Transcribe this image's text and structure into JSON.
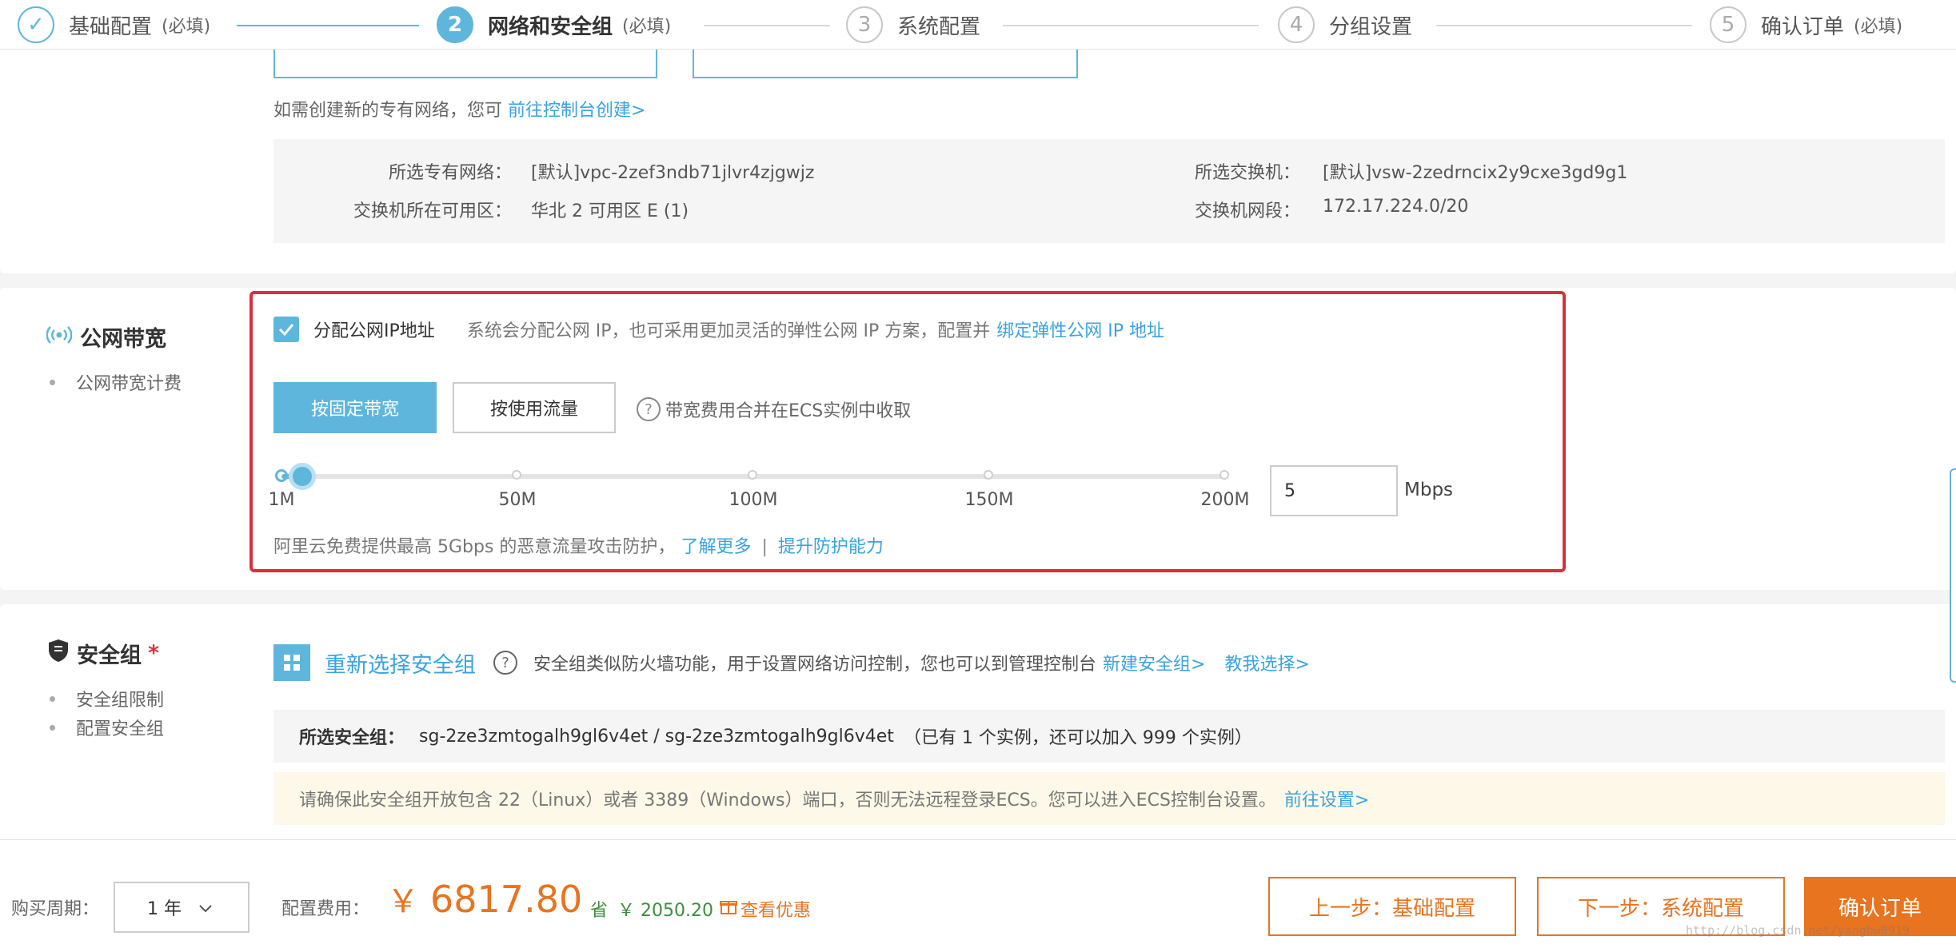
{
  "steps": [
    {
      "num": "✓",
      "label": "基础配置",
      "req": "(必填)"
    },
    {
      "num": "2",
      "label": "网络和安全组",
      "req": "(必填)"
    },
    {
      "num": "3",
      "label": "系统配置",
      "req": ""
    },
    {
      "num": "4",
      "label": "分组设置",
      "req": ""
    },
    {
      "num": "5",
      "label": "确认订单",
      "req": "(必填)"
    }
  ],
  "vpc": {
    "hint": "如需创建新的专有网络，您可",
    "hint_link": "前往控制台创建>",
    "vpc_label": "所选专有网络：",
    "vpc_value": "[默认]vpc-2zef3ndb71jlvr4zjgwjz",
    "zone_label": "交换机所在可用区：",
    "zone_value": "华北 2 可用区 E (1)",
    "switch_label": "所选交换机：",
    "switch_value": "[默认]vsw-2zedrncix2y9cxe3gd9g1",
    "cidr_label": "交换机网段：",
    "cidr_value": "172.17.224.0/20"
  },
  "bandwidth": {
    "title": "公网带宽",
    "bullet": "公网带宽计费",
    "assign_ip_checked": true,
    "assign_ip_label": "分配公网IP地址",
    "assign_desc": "系统会分配公网 IP，也可采用更加灵活的弹性公网 IP 方案，配置并",
    "assign_link": "绑定弹性公网 IP 地址",
    "fixed_btn": "按固定带宽",
    "traffic_btn": "按使用流量",
    "fee_note": "带宽费用合并在ECS实例中收取",
    "ticks": [
      "1M",
      "50M",
      "100M",
      "150M",
      "200M"
    ],
    "slider_min": 1,
    "slider_max": 200,
    "slider_value": 5,
    "input_value": "5",
    "unit": "Mbps",
    "ddos_text": "阿里云免费提供最高 5Gbps 的恶意流量攻击防护，",
    "learn_more": "了解更多",
    "separator": "|",
    "upgrade": "提升防护能力",
    "accent": "#5fb6dd",
    "highlight": "#d7303d"
  },
  "security": {
    "title": "安全组",
    "required_mark": "*",
    "bullets": [
      "安全组限制",
      "配置安全组"
    ],
    "reselect": "重新选择安全组",
    "desc": "安全组类似防火墙功能，用于设置网络访问控制，您也可以到管理控制台",
    "new_link": "新建安全组>",
    "teach_link": "教我选择>",
    "selected_label": "所选安全组：",
    "selected_value": "sg-2ze3zmtogalh9gl6v4et  / sg-2ze3zmtogalh9gl6v4et",
    "selected_note": "（已有 1 个实例，还可以加入 999 个实例）",
    "warning": "请确保此安全组开放包含 22（Linux）或者 3389（Windows）端口，否则无法远程登录ECS。您可以进入ECS控制台设置。",
    "warning_link": "前往设置>"
  },
  "footer": {
    "period_label": "购买周期：",
    "period_value": "1 年",
    "fee_label": "配置费用：",
    "currency": "￥",
    "price": "6817.80",
    "save_label": "省",
    "save_amount": "￥ 2050.20",
    "discount_link": "查看优惠",
    "prev_btn": "上一步：基础配置",
    "next_btn": "下一步：系统配置",
    "confirm_btn": "确认订单",
    "orange": "#e8741f",
    "watermark": "http://blog.csdn.net/yangbw0919"
  }
}
